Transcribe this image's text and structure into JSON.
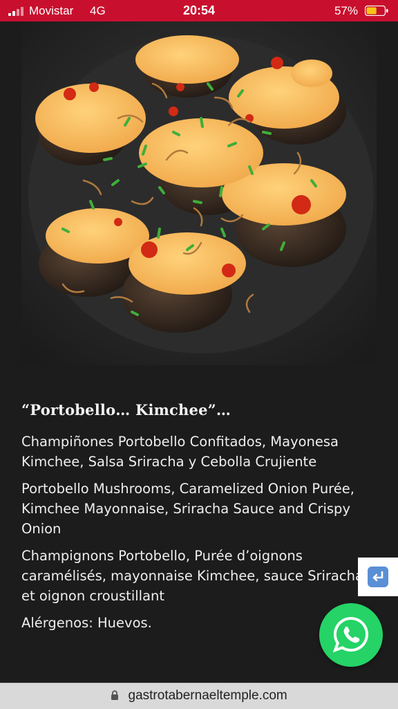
{
  "status_bar": {
    "carrier": "Movistar",
    "network": "4G",
    "time": "20:54",
    "battery_percent": "57%",
    "battery_level": 0.57,
    "background_color": "#c8102e"
  },
  "dish": {
    "title": "“Portobello… Kimchee”…",
    "description_es": "Champiñones Portobello Confitados, Mayonesa Kimchee, Salsa Sriracha y Cebolla Crujiente",
    "description_en": "Portobello Mushrooms, Caramelized Onion Purée, Kimchee Mayonnaise, Sriracha Sauce and Crispy Onion",
    "description_fr": "Champignons Portobello, Purée d’oignons caramélisés, mayonnaise Kimchee, sauce Sriracha et oignon croustillant",
    "allergens": "Alérgenos: Huevos."
  },
  "buttons": {
    "return_icon": "return-arrow-icon",
    "whatsapp_icon": "whatsapp-icon",
    "whatsapp_color": "#25d366"
  },
  "url_bar": {
    "domain": "gastrotabernaeltemple.com",
    "lock_icon": "lock-icon"
  }
}
